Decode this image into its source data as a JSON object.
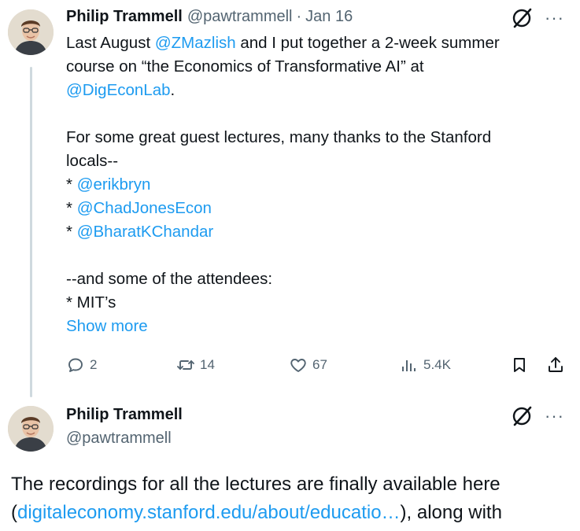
{
  "tweet1": {
    "author_name": "Philip Trammell",
    "author_handle": "@pawtrammell",
    "separator": "·",
    "date": "Jan 16",
    "more_label": "···",
    "lines": [
      [
        {
          "t": "Last August "
        },
        {
          "t": "@ZMazlish",
          "link": true
        },
        {
          "t": " and I put together a 2-week summer"
        }
      ],
      [
        {
          "t": "course on “the Economics of Transformative AI” at"
        }
      ],
      [
        {
          "t": "@DigEconLab",
          "link": true
        },
        {
          "t": "."
        }
      ],
      [
        {
          "t": ""
        }
      ],
      [
        {
          "t": "For some great guest lectures, many thanks to the Stanford"
        }
      ],
      [
        {
          "t": "locals--"
        }
      ],
      [
        {
          "t": "* "
        },
        {
          "t": "@erikbryn",
          "link": true
        }
      ],
      [
        {
          "t": "* "
        },
        {
          "t": "@ChadJonesEcon",
          "link": true
        }
      ],
      [
        {
          "t": "* "
        },
        {
          "t": "@BharatKChandar",
          "link": true
        }
      ],
      [
        {
          "t": ""
        }
      ],
      [
        {
          "t": "--and some of the attendees:"
        }
      ],
      [
        {
          "t": "* MIT’s"
        }
      ]
    ],
    "show_more": "Show more",
    "actions": {
      "replies": "2",
      "retweets": "14",
      "likes": "67",
      "views": "5.4K"
    }
  },
  "tweet2": {
    "author_name": "Philip Trammell",
    "author_handle": "@pawtrammell",
    "more_label": "···",
    "lines": [
      [
        {
          "t": "The recordings for all the lectures are finally available here"
        }
      ],
      [
        {
          "t": "("
        },
        {
          "t": "digitaleconomy.stanford.edu/about/educatio…",
          "link": true
        },
        {
          "t": "), along with"
        }
      ]
    ]
  },
  "colors": {
    "link": "#1d9bf0",
    "muted": "#536471",
    "text": "#0f1419",
    "thread_line": "#cfd9de"
  },
  "icons": {
    "grok": "slashed-circle-icon",
    "reply": "speech-bubble-icon",
    "retweet": "retweet-arrows-icon",
    "like": "heart-icon",
    "views": "bar-chart-icon",
    "bookmark": "bookmark-icon",
    "share": "share-icon"
  }
}
